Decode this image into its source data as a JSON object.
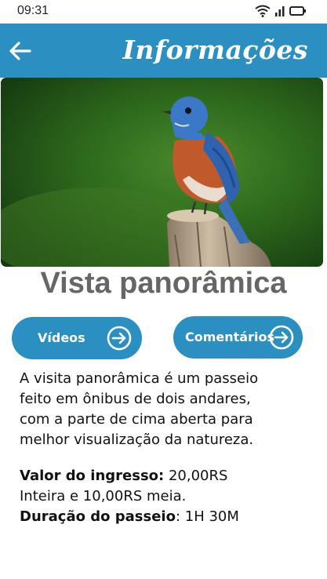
{
  "status_bar": {
    "time": "09:31",
    "icons": [
      "wifi-icon",
      "signal-icon",
      "battery-icon"
    ]
  },
  "app_bar": {
    "back_icon": "arrow-left-icon",
    "title": "Informações",
    "color": "#2b8fc2"
  },
  "hero_image": {
    "subject": "bird perched on wooden post"
  },
  "place": {
    "title": "Vista panorâmica"
  },
  "buttons": {
    "videos": {
      "label": "Vídeos",
      "icon": "arrow-right-circle-icon"
    },
    "comments": {
      "label": "Comentários",
      "icon": "arrow-right-circle-icon"
    }
  },
  "description": {
    "lines": [
      "A visita panorâmica é um passeio",
      "feito em ônibus de dois andares,",
      "com a parte de cima aberta para",
      "melhor visualização da natureza."
    ]
  },
  "info": {
    "price_label": "Valor do ingresso:",
    "price_value": " 20,00RS",
    "price_line2": "Inteira e 10,00RS meia.",
    "duration_label": "Duração do passeio",
    "duration_value": ": 1H 30M"
  }
}
